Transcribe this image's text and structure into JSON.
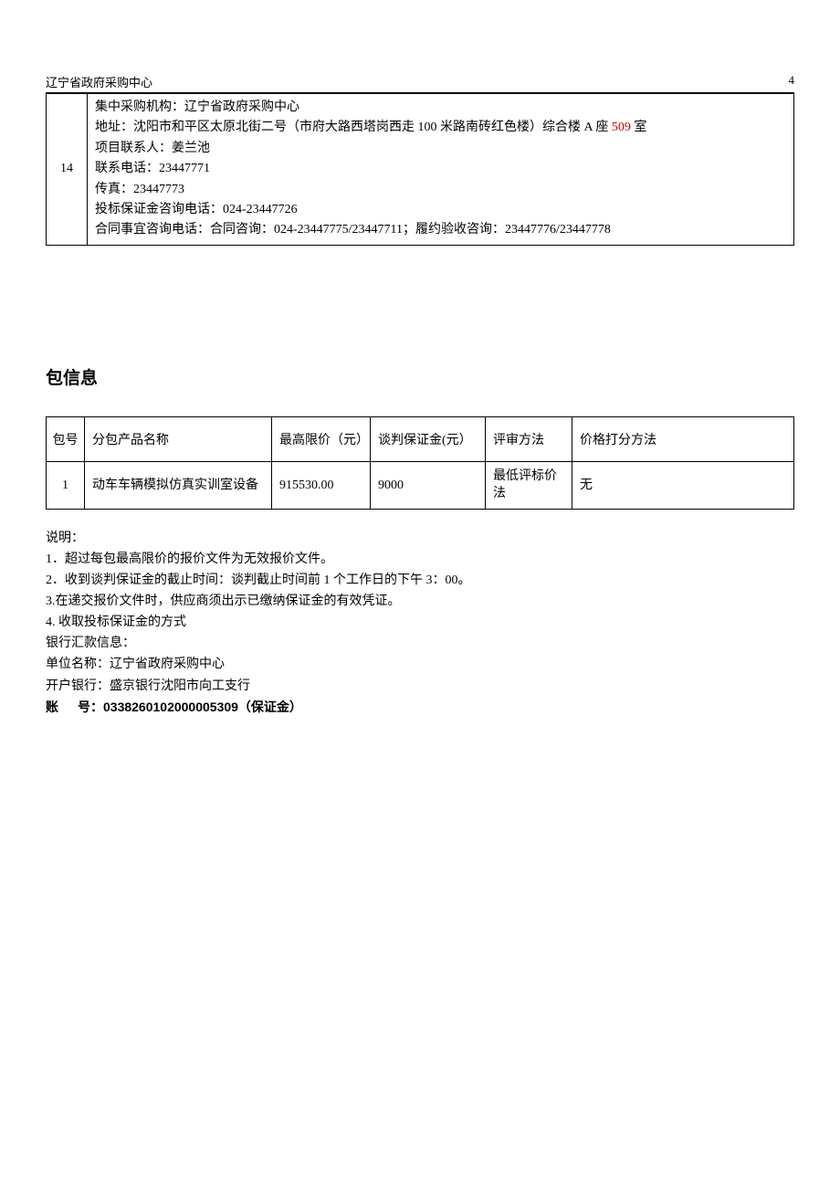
{
  "header": {
    "org": "辽宁省政府采购中心",
    "page_num": "4"
  },
  "contact_block": {
    "row_num": "14",
    "line1": "集中采购机构：辽宁省政府采购中心",
    "addr_prefix": "地址：沈阳市和平区太原北街二号（市府大路西塔岗西走 100 米路南砖红色楼）综合楼 A 座 ",
    "addr_red": "509",
    "addr_suffix": " 室",
    "line3": "项目联系人：姜兰池",
    "line4": "联系电话：23447771",
    "line5": "传真：23447773",
    "line6": "投标保证金咨询电话：024-23447726",
    "line7": "合同事宜咨询电话：合同咨询：024-23447775/23447711；履约验收咨询：23447776/23447778"
  },
  "package_section": {
    "title": "包信息",
    "headers": {
      "h1": "包号",
      "h2": "分包产品名称",
      "h3": "最高限价（元）",
      "h4": "谈判保证金(元）",
      "h5": "评审方法",
      "h6": "价格打分方法"
    },
    "row": {
      "c1": "1",
      "c2": "动车车辆模拟仿真实训室设备",
      "c3": "915530.00",
      "c4": "9000",
      "c5": "最低评标价法",
      "c6": "无"
    }
  },
  "notes": {
    "n0": "说明：",
    "n1": "1．超过每包最高限价的报价文件为无效报价文件。",
    "n2": "2．收到谈判保证金的截止时间：谈判截止时间前 1 个工作日的下午 3：00。",
    "n3": "3.在递交报价文件时，供应商须出示已缴纳保证金的有效凭证。",
    "n4": "4. 收取投标保证金的方式",
    "n5": "银行汇款信息：",
    "n6": "单位名称：辽宁省政府采购中心",
    "n7": "开户银行：盛京银行沈阳市向工支行",
    "acct_label_a": "账",
    "acct_label_b": "号：",
    "acct_val": "0338260102000005309（保证金）"
  }
}
